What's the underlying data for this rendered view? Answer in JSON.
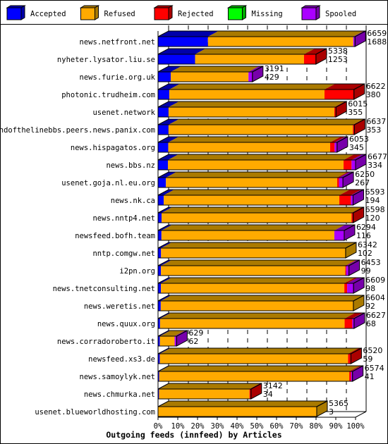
{
  "chart_data": {
    "type": "bar",
    "orientation": "horizontal",
    "stacked": true,
    "three_d": true,
    "title": "Outgoing feeds (innfeed) by Articles",
    "xlabel": "Outgoing feeds (innfeed) by Articles",
    "ylabel": "",
    "xlim": [
      0,
      100
    ],
    "x_unit": "%",
    "scale_max_articles": 6677,
    "x_ticks": [
      "0%",
      "10%",
      "20%",
      "30%",
      "40%",
      "50%",
      "60%",
      "70%",
      "80%",
      "90%",
      "100%"
    ],
    "grid": true,
    "legend_position": "top",
    "legend": [
      {
        "name": "Accepted",
        "color": "#0000ff",
        "shade": "#0000aa"
      },
      {
        "name": "Refused",
        "color": "#ffaa00",
        "shade": "#aa7a00"
      },
      {
        "name": "Rejected",
        "color": "#ff0000",
        "shade": "#aa0000"
      },
      {
        "name": "Missing",
        "color": "#00ff00",
        "shade": "#00aa00"
      },
      {
        "name": "Spooled",
        "color": "#aa00ff",
        "shade": "#7700aa"
      }
    ],
    "categories": [
      "news.netfront.net",
      "nyheter.lysator.liu.se",
      "news.furie.org.uk",
      "photonic.trudheim.com",
      "usenet.network",
      "endofthelinebbs.peers.news.panix.com",
      "news.hispagatos.org",
      "news.bbs.nz",
      "usenet.goja.nl.eu.org",
      "news.nk.ca",
      "news.nntp4.net",
      "newsfeed.bofh.team",
      "nntp.comgw.net",
      "i2pn.org",
      "news.tnetconsulting.net",
      "news.weretis.net",
      "news.quux.org",
      "news.corradoroberto.it",
      "newsfeed.xs3.de",
      "news.samoylyk.net",
      "news.chmurka.net",
      "usenet.blueworldhosting.com"
    ],
    "totals": [
      6659,
      5338,
      3191,
      6622,
      6015,
      6637,
      6053,
      6677,
      6250,
      6593,
      6598,
      6294,
      6342,
      6453,
      6609,
      6604,
      6627,
      629,
      6520,
      6574,
      3142,
      5365
    ],
    "series": [
      {
        "name": "Accepted",
        "values": [
          1688,
          1253,
          429,
          380,
          355,
          353,
          345,
          334,
          267,
          194,
          120,
          116,
          102,
          99,
          98,
          92,
          68,
          62,
          59,
          41,
          34,
          3
        ]
      },
      {
        "name": "Refused",
        "values": [
          4912,
          3683,
          2628,
          5248,
          5605,
          6234,
          5474,
          5938,
          5790,
          5935,
          6420,
          5844,
          6240,
          6230,
          6200,
          6512,
          6240,
          500,
          6365,
          6423,
          3058,
          5362
        ]
      },
      {
        "name": "Rejected",
        "values": [
          0,
          402,
          0,
          994,
          55,
          50,
          150,
          270,
          60,
          390,
          58,
          0,
          0,
          30,
          95,
          0,
          260,
          0,
          96,
          60,
          50,
          0
        ]
      },
      {
        "name": "Missing",
        "values": [
          0,
          0,
          0,
          0,
          0,
          0,
          0,
          0,
          0,
          0,
          0,
          0,
          0,
          0,
          0,
          0,
          0,
          0,
          0,
          0,
          0,
          0
        ]
      },
      {
        "name": "Spooled",
        "values": [
          59,
          0,
          134,
          0,
          0,
          0,
          84,
          135,
          133,
          74,
          0,
          334,
          0,
          94,
          216,
          0,
          59,
          67,
          0,
          50,
          0,
          0
        ]
      }
    ]
  }
}
